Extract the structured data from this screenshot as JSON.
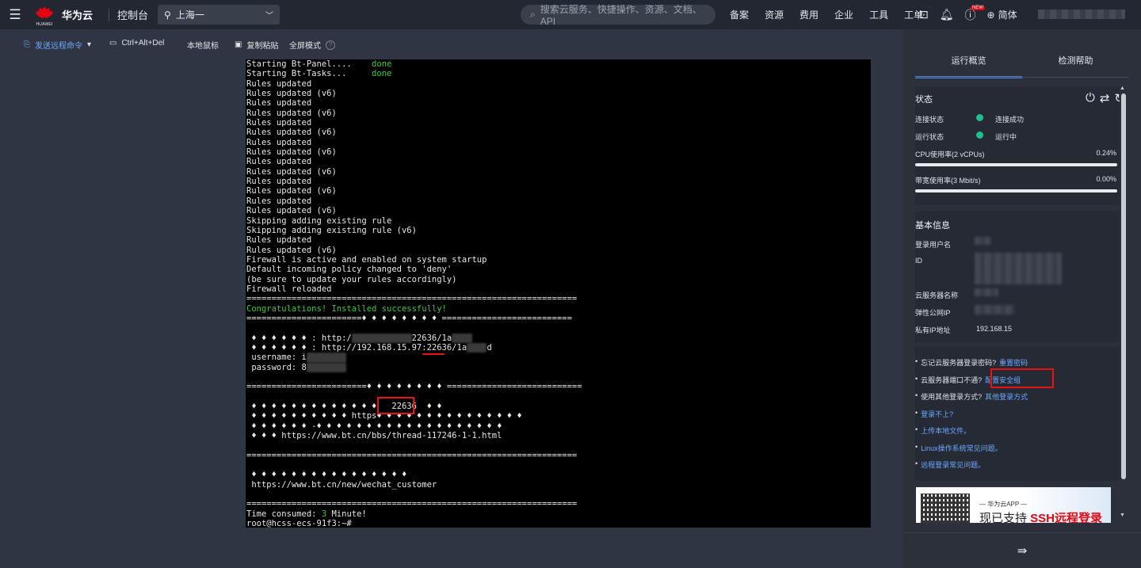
{
  "topbar": {
    "brand_sub": "HUAWEI",
    "brand_name": "华为云",
    "console": "控制台",
    "region": "上海一",
    "search_placeholder": "搜索云服务、快捷操作、资源、文档、API",
    "nav": [
      "备案",
      "资源",
      "费用",
      "企业",
      "工具",
      "工单"
    ],
    "badge_new": "NEW",
    "lang": "简体"
  },
  "toolbar": {
    "send_cmd": "发送远程命令",
    "ctrl_alt_del": "Ctrl+Alt+Del",
    "local_mouse": "本地鼠标",
    "copy_paste": "复制粘贴",
    "fullscreen": "全屏模式"
  },
  "terminal": {
    "lines": [
      {
        "t": "Starting Bt-Panel....    ",
        "g": "done"
      },
      {
        "t": "Starting Bt-Tasks...     ",
        "g": "done"
      },
      {
        "t": "Rules updated"
      },
      {
        "t": "Rules updated (v6)"
      },
      {
        "t": "Rules updated"
      },
      {
        "t": "Rules updated (v6)"
      },
      {
        "t": "Rules updated"
      },
      {
        "t": "Rules updated (v6)"
      },
      {
        "t": "Rules updated"
      },
      {
        "t": "Rules updated (v6)"
      },
      {
        "t": "Rules updated"
      },
      {
        "t": "Rules updated (v6)"
      },
      {
        "t": "Rules updated"
      },
      {
        "t": "Rules updated (v6)"
      },
      {
        "t": "Rules updated"
      },
      {
        "t": "Rules updated (v6)"
      },
      {
        "t": "Skipping adding existing rule"
      },
      {
        "t": "Skipping adding existing rule (v6)"
      },
      {
        "t": "Rules updated"
      },
      {
        "t": "Rules updated (v6)"
      },
      {
        "t": "Firewall is active and enabled on system startup"
      },
      {
        "t": "Default incoming policy changed to 'deny'"
      },
      {
        "t": "(be sure to update your rules accordingly)"
      },
      {
        "t": "Firewall reloaded"
      },
      {
        "t": "=================================================================="
      },
      {
        "g": "Congratulations! Installed successfully!"
      },
      {
        "t": "=======================♦ ♦ ♦ ♦ ♦ ♦ ♦ ♦ =========================="
      },
      {
        "t": ""
      },
      {
        "t": " ♦ ♦ ♦ ♦ ♦ ♦ : http:/",
        "b": "XXXXXXXXXXXX",
        "t2": "22636/1a",
        "b2": "XXXX"
      },
      {
        "t": " ♦ ♦ ♦ ♦ ♦ ♦ : http://192.168.15.97:22636/1a",
        "b": "XXXX",
        "t2": "d"
      },
      {
        "t": " username: i",
        "b": "XXXXXXXX"
      },
      {
        "t": " password: 8",
        "b": "XXXXXXXX"
      },
      {
        "t": ""
      },
      {
        "t": "========================♦ ♦ ♦ ♦ ♦ ♦ ♦ ♦ ==========================="
      },
      {
        "t": ""
      },
      {
        "t": " ♦ ♦ ♦ ♦ ♦ ♦ ♦ ♦ ♦ ♦ ♦ ♦ ♦   22636  ♦ ♦"
      },
      {
        "t": " ♦ ♦ ♦ ♦ ♦ ♦ ♦ ♦ ♦ ♦ https♦ ♦ ♦ ♦ ♦ ♦ ♦ ♦ ♦ ♦ ♦ ♦ ♦ ♦ ♦"
      },
      {
        "t": " ♦ ♦ ♦ ♦ ♦ ♦ -♦ ♦ ♦ ♦ ♦ ♦ ♦ ♦ ♦ ♦ ♦ ♦ ♦ ♦ ♦ ♦ ♦ ♦ ♦"
      },
      {
        "t": " ♦ ♦ ♦ https://www.bt.cn/bbs/thread-117246-1-1.html"
      },
      {
        "t": ""
      },
      {
        "t": "=================================================================="
      },
      {
        "t": ""
      },
      {
        "t": " ♦ ♦ ♦ ♦ ♦ ♦ ♦ ♦ ♦ ♦ ♦ ♦ ♦ ♦ ♦ ♦"
      },
      {
        "t": " https://www.bt.cn/new/wechat_customer"
      },
      {
        "t": ""
      },
      {
        "t": "=================================================================="
      },
      {
        "t": "Time consumed: ",
        "g": "3",
        "t2": " Minute!"
      },
      {
        "t": "root@hcss-ecs-91f3:~#"
      }
    ]
  },
  "panel": {
    "tabs": [
      "运行概览",
      "检测帮助"
    ],
    "status": {
      "title": "状态",
      "conn_label": "连接状态",
      "conn_value": "连接成功",
      "run_label": "运行状态",
      "run_value": "运行中",
      "cpu_label": "CPU使用率(2 vCPUs)",
      "cpu_value": "0.24%",
      "cpu_fraction": 0.0024,
      "bw_label": "带宽使用率(3 Mbit/s)",
      "bw_value": "0.00%",
      "bw_fraction": 0.0
    },
    "basic": {
      "title": "基本信息",
      "login_user": "登录用户名",
      "id": "ID",
      "server_name": "云服务器名称",
      "eip": "弹性公网IP",
      "private_ip_label": "私有IP地址",
      "private_ip_value": "192.168.15"
    },
    "tips": [
      {
        "text": "忘记云服务器登录密码?",
        "link": "重置密码"
      },
      {
        "text": "云服务器端口不通?",
        "link": "配置安全组"
      },
      {
        "text": "使用其他登录方式?",
        "link": "其他登录方式"
      },
      {
        "text": "",
        "link": "登录不上?"
      },
      {
        "text": "",
        "link": "上传本地文件。"
      },
      {
        "text": "",
        "link": "Linux操作系统常见问题。"
      },
      {
        "text": "",
        "link": "远程登录常见问题。"
      }
    ],
    "banner": {
      "app": "— 华为云APP —",
      "text": "现已支持 ",
      "highlight": "SSH远程登录"
    }
  },
  "colors": {
    "accent": "#4f7fd9",
    "link": "#6ea8ff",
    "success": "#1fbf8f",
    "terminal_green": "#3ec93e",
    "annotation_red": "#ee1111"
  }
}
